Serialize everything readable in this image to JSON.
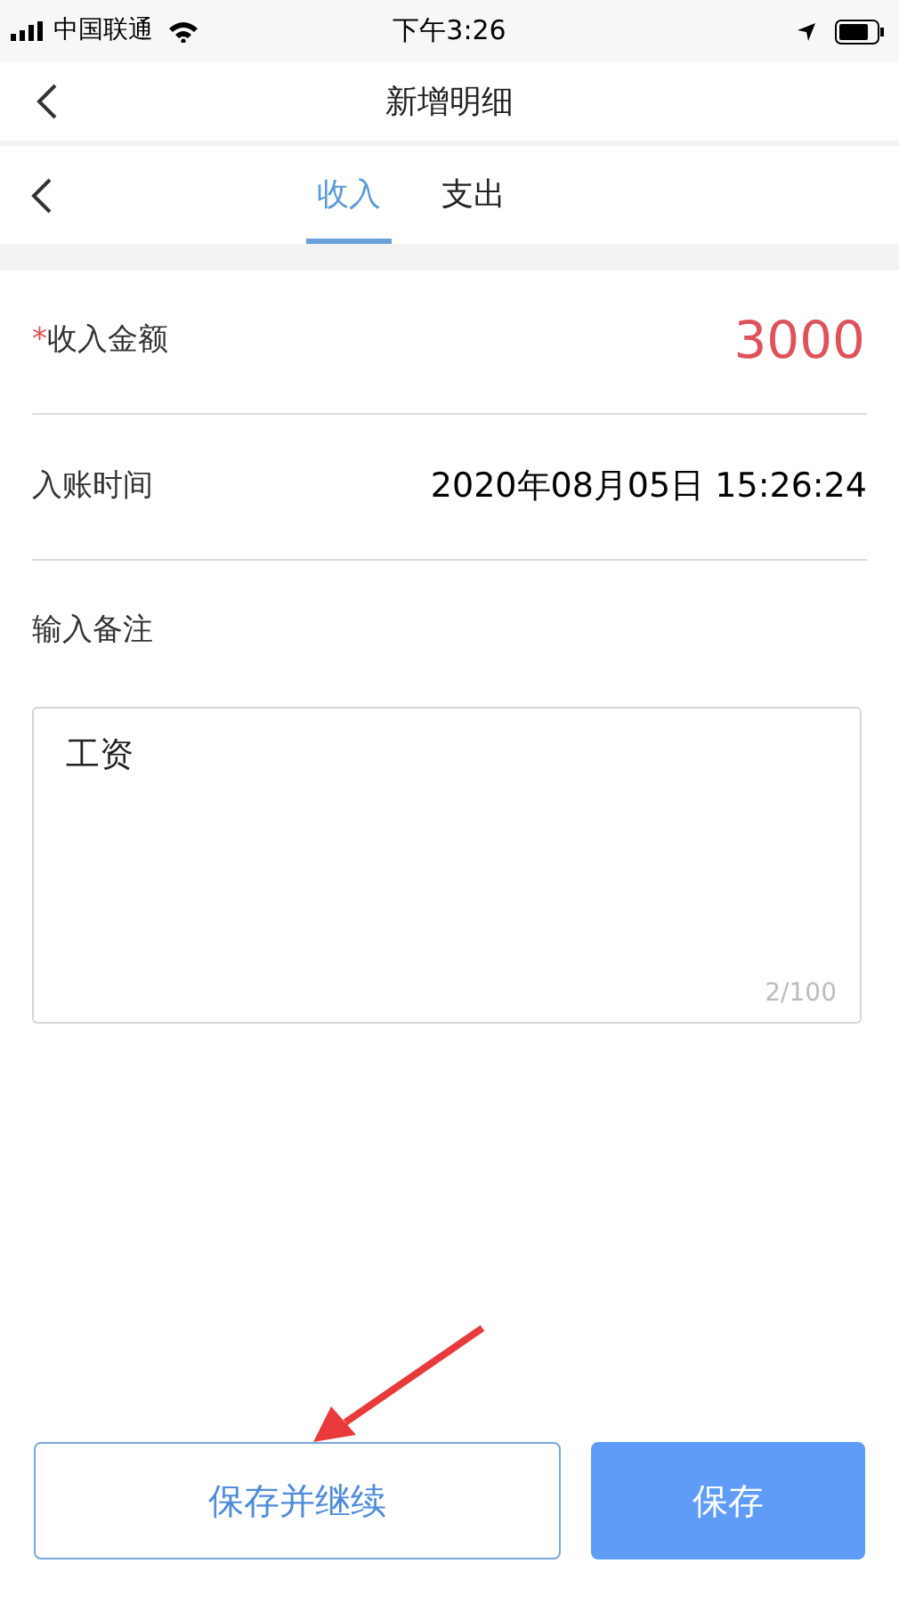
{
  "status_bar": {
    "carrier": "中国联通",
    "time": "下午3:26"
  },
  "nav_bar": {
    "title": "新增明细"
  },
  "tabs": [
    {
      "label": "收入",
      "selected": true
    },
    {
      "label": "支出",
      "selected": false
    }
  ],
  "form": {
    "amount": {
      "required_mark": "*",
      "label": "收入金额",
      "value": "3000"
    },
    "time": {
      "label": "入账时间",
      "value": "2020年08月05日 15:26:24"
    },
    "remark": {
      "label": "输入备注",
      "value": "工资",
      "counter": "2/100"
    }
  },
  "buttons": [
    {
      "label": "保存并继续",
      "kind": "outline"
    },
    {
      "label": "保存",
      "kind": "primary"
    }
  ]
}
